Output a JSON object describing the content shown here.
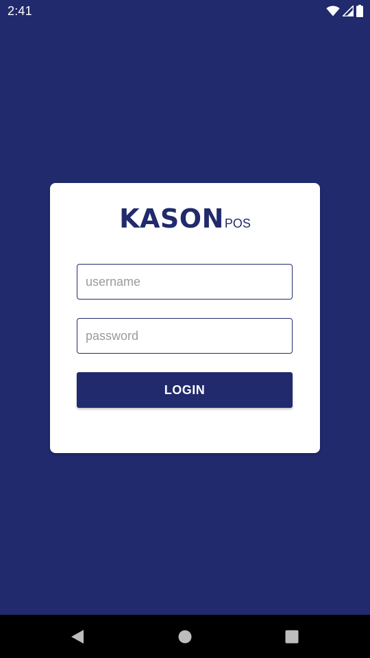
{
  "status_bar": {
    "time": "2:41",
    "icons": [
      "wifi-icon",
      "signal-icon",
      "battery-icon"
    ]
  },
  "login_card": {
    "logo_main": "KASON",
    "logo_sub": "POS",
    "username_placeholder": "username",
    "username_value": "",
    "password_placeholder": "password",
    "password_value": "",
    "login_label": "LOGIN"
  },
  "nav_bar": {
    "buttons": [
      "back-icon",
      "home-icon",
      "recents-icon"
    ]
  },
  "colors": {
    "background": "#202a6c",
    "card": "#ffffff",
    "accent": "#202a6c",
    "placeholder": "#9b9b9b"
  }
}
